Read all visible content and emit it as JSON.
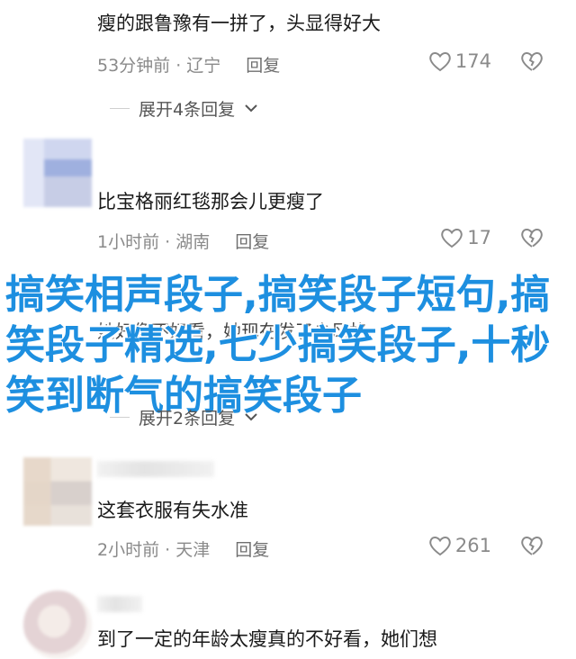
{
  "comments": [
    {
      "text": "瘦的跟鲁豫有一拼了，头显得好大",
      "time_location": "53分钟前 · 辽宁",
      "reply_label": "回复",
      "likes": "174",
      "expand_label": "展开4条回复"
    },
    {
      "text": "比宝格丽红毯那会儿更瘦了",
      "time_location": "1小时前 · 湖南",
      "reply_label": "回复",
      "likes": "17",
      "partial_text": "她好像不好看，她现在发了少风格",
      "expand_label": "展开2条回复"
    },
    {
      "text": "这套衣服有失水准",
      "time_location": "2小时前 · 天津",
      "reply_label": "回复",
      "likes": "261"
    },
    {
      "text": "到了一定的年龄太瘦真的不好看，她们想"
    }
  ],
  "banner": {
    "text": "搞笑相声段子,搞笑段子短句,搞笑段子精选,七少搞笑段子,十秒笑到断气的搞笑段子"
  },
  "colors": {
    "banner": "#1d8fe0",
    "meta_text": "#8a8a8a"
  },
  "icons": {
    "like": "heart-outline-icon",
    "dislike": "broken-heart-icon",
    "expand": "chevron-down-icon"
  }
}
